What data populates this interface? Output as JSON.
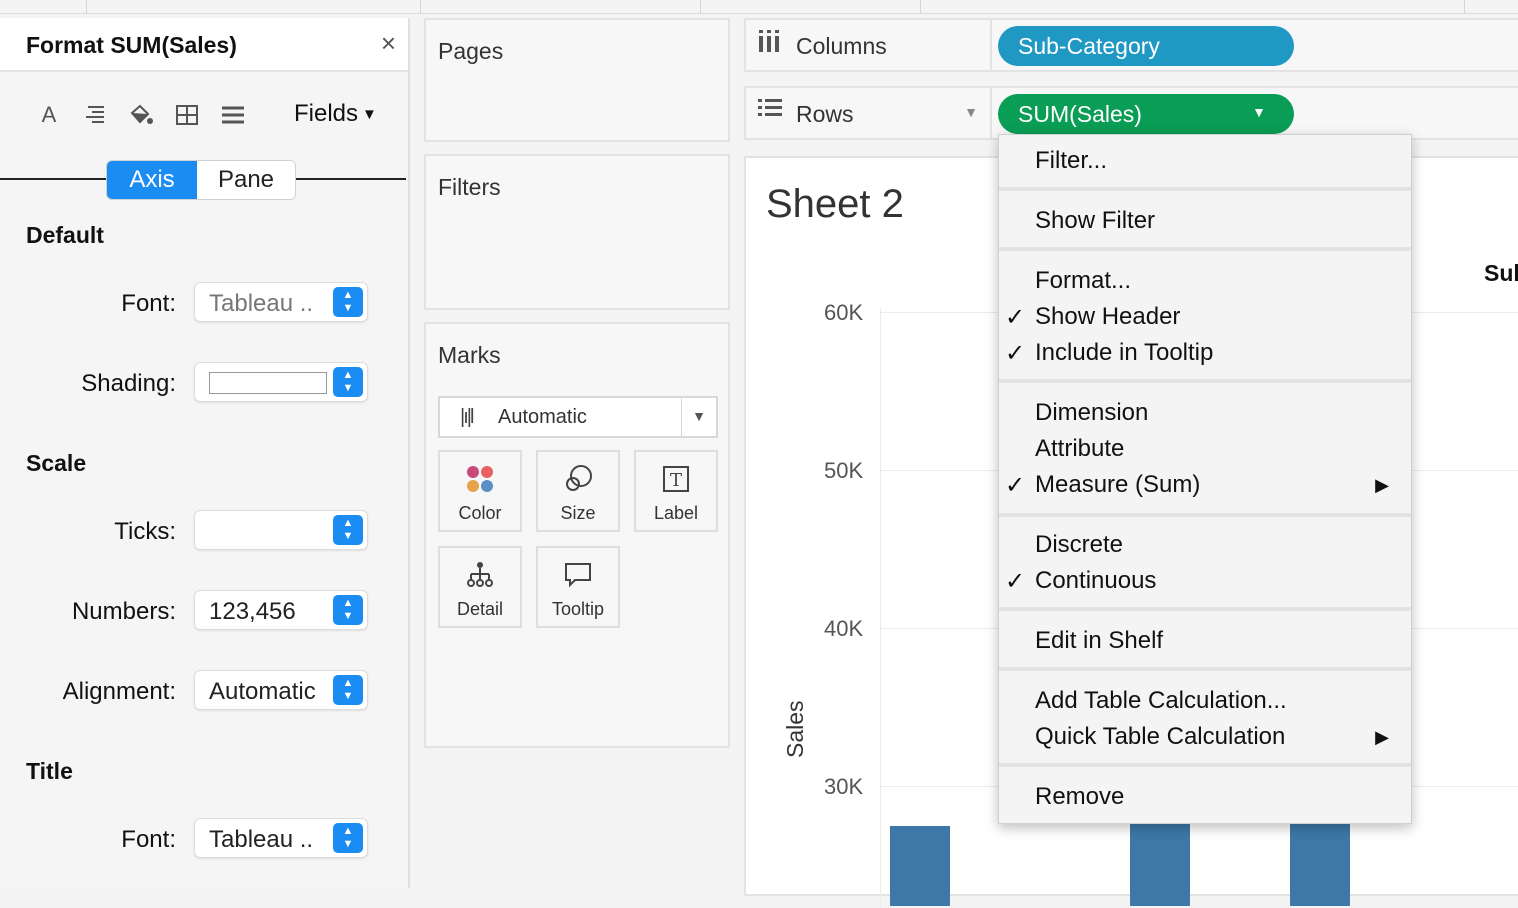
{
  "format_panel": {
    "title": "Format SUM(Sales)",
    "close": "×",
    "fields_label": "Fields",
    "tabs": [
      "Axis",
      "Pane"
    ],
    "default_section": "Default",
    "scale_section": "Scale",
    "title_section": "Title",
    "rows": {
      "font_label": "Font:",
      "font_value": "Tableau ..",
      "shading_label": "Shading:",
      "ticks_label": "Ticks:",
      "numbers_label": "Numbers:",
      "numbers_value": "123,456",
      "alignment_label": "Alignment:",
      "alignment_value": "Automatic",
      "title_font_label": "Font:",
      "title_font_value": "Tableau .."
    }
  },
  "cards": {
    "pages": "Pages",
    "filters": "Filters",
    "marks": "Marks",
    "marks_type": "Automatic",
    "mark_buttons": [
      "Color",
      "Size",
      "Label",
      "Detail",
      "Tooltip"
    ]
  },
  "shelves": {
    "columns_label": "Columns",
    "rows_label": "Rows",
    "columns_pill": "Sub-Category",
    "rows_pill": "SUM(Sales)"
  },
  "sheet": {
    "title": "Sheet 2",
    "y_label": "Sales",
    "column_header": "Sub",
    "y_ticks": [
      "60K",
      "50K",
      "40K",
      "30K"
    ]
  },
  "context_menu": {
    "items": [
      {
        "label": "Filter...",
        "checked": false,
        "submenu": false
      },
      {
        "label": "Show Filter",
        "checked": false,
        "submenu": false
      },
      {
        "label": "Format...",
        "checked": false,
        "submenu": false
      },
      {
        "label": "Show Header",
        "checked": true,
        "submenu": false
      },
      {
        "label": "Include in Tooltip",
        "checked": true,
        "submenu": false
      },
      {
        "label": "Dimension",
        "checked": false,
        "submenu": false
      },
      {
        "label": "Attribute",
        "checked": false,
        "submenu": false
      },
      {
        "label": "Measure (Sum)",
        "checked": true,
        "submenu": true
      },
      {
        "label": "Discrete",
        "checked": false,
        "submenu": false
      },
      {
        "label": "Continuous",
        "checked": true,
        "submenu": false
      },
      {
        "label": "Edit in Shelf",
        "checked": false,
        "submenu": false
      },
      {
        "label": "Add Table Calculation...",
        "checked": false,
        "submenu": false
      },
      {
        "label": "Quick Table Calculation",
        "checked": false,
        "submenu": true
      },
      {
        "label": "Remove",
        "checked": false,
        "submenu": false
      }
    ]
  },
  "colors": {
    "accent_blue": "#1b8cf2",
    "dimension_pill": "#1f98c4",
    "measure_pill": "#0a9d55",
    "bar": "#3d78a8"
  }
}
